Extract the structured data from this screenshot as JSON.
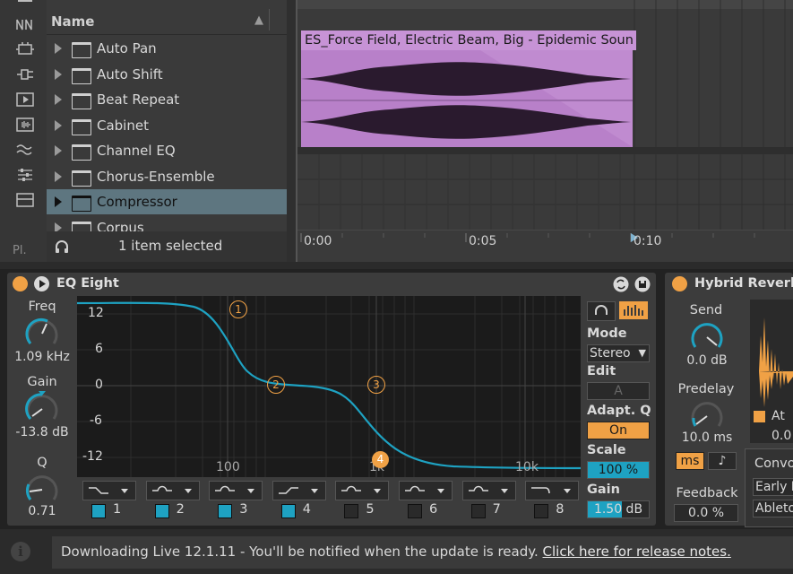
{
  "browser": {
    "header": "Name",
    "items": [
      {
        "label": "Auto Pan"
      },
      {
        "label": "Auto Shift"
      },
      {
        "label": "Beat Repeat"
      },
      {
        "label": "Cabinet"
      },
      {
        "label": "Channel EQ"
      },
      {
        "label": "Chorus-Ensemble"
      },
      {
        "label": "Compressor"
      },
      {
        "label": "Corpus"
      }
    ],
    "selected_index": 6,
    "status": "1 item selected",
    "sidebar_bottom": "Pl."
  },
  "arrangement": {
    "clip_title": "ES_Force Field, Electric Beam, Big - Epidemic Soun",
    "clip_color": "#b880c9",
    "timeline": [
      "0:00",
      "0:05",
      "0:10"
    ]
  },
  "eq_eight": {
    "title": "EQ Eight",
    "freq_label": "Freq",
    "freq_value": "1.09 kHz",
    "gain_label": "Gain",
    "gain_value": "-13.8 dB",
    "q_label": "Q",
    "q_value": "0.71",
    "y_ticks": [
      "12",
      "6",
      "0",
      "-6",
      "-12"
    ],
    "x_ticks": [
      "100",
      "1k",
      "10k"
    ],
    "band_markers": [
      "1",
      "2",
      "3",
      "4"
    ],
    "mode_label": "Mode",
    "mode_value": "Stereo",
    "edit_label": "Edit",
    "edit_value": "A",
    "adaptq_label": "Adapt. Q",
    "adaptq_value": "On",
    "scale_label": "Scale",
    "scale_value": "100 %",
    "gain2_label": "Gain",
    "gain2_value": "1.50 dB",
    "bands": [
      {
        "num": "1",
        "on": true
      },
      {
        "num": "2",
        "on": true
      },
      {
        "num": "3",
        "on": true
      },
      {
        "num": "4",
        "on": true
      },
      {
        "num": "5",
        "on": false
      },
      {
        "num": "6",
        "on": false
      },
      {
        "num": "7",
        "on": false
      },
      {
        "num": "8",
        "on": false
      }
    ],
    "accent": "#1ea2c2"
  },
  "reverb": {
    "title": "Hybrid Reverb",
    "send_label": "Send",
    "send_value": "0.0 dB",
    "predelay_label": "Predelay",
    "predelay_value": "10.0 ms",
    "ms_label": "ms",
    "note_icon": "♪",
    "feedback_label": "Feedback",
    "feedback_value": "0.0 %",
    "conv_label": "Convo",
    "early_label": "Early I",
    "ableton_label": "Ableto",
    "at_label": "At",
    "at_value": "0.0"
  },
  "status": {
    "message": "Downloading Live 12.1.11 - You'll be notified when the update is ready.",
    "link": "Click here for release notes."
  }
}
